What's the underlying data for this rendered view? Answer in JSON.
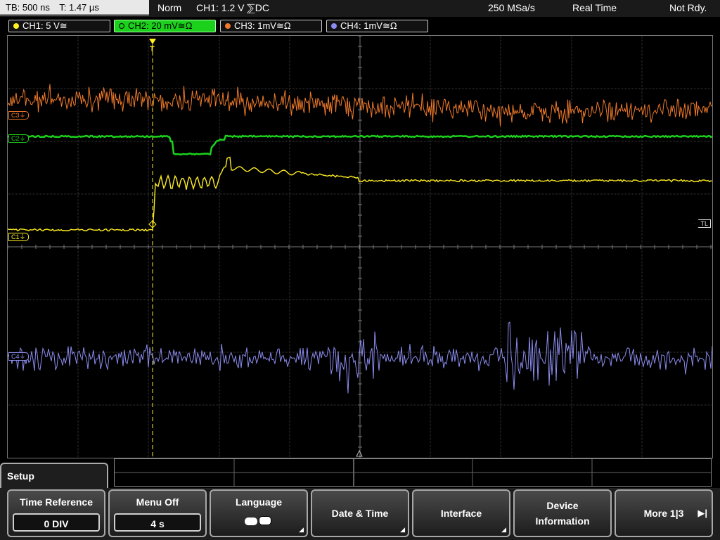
{
  "status_bar": {
    "timebase": "TB: 500 ns",
    "trigger_time": "T: 1.47 µs",
    "mode": "Norm",
    "trigger_info": "CH1: 1.2 V ⅀DC",
    "sample_rate": "250 MSa/s",
    "acq_mode": "Real Time",
    "state": "Not Rdy."
  },
  "channels": [
    {
      "label": "CH1: 5 V≅",
      "color": "#ffee22",
      "active": false
    },
    {
      "label": "CH2: 20 mV≅Ω",
      "color": "#1bd11b",
      "active": true
    },
    {
      "label": "CH3: 1mV≅Ω",
      "color": "#f07a2a",
      "active": false
    },
    {
      "label": "CH4: 1mV≅Ω",
      "color": "#8c8cf0",
      "active": false
    }
  ],
  "markers": {
    "c3": "C3⏚",
    "c2": "C2⏚",
    "c1": "C1⏚",
    "c4": "C4⏚",
    "trigger_level": "TL",
    "trigger_position": "T"
  },
  "menu": {
    "title": "Setup",
    "softkeys": [
      {
        "label": "Time Reference",
        "value": "0 DIV"
      },
      {
        "label": "Menu Off",
        "value": "4 s"
      },
      {
        "label": "Language",
        "icon": "speech-bubbles-icon"
      },
      {
        "label": "Date & Time"
      },
      {
        "label": "Interface"
      },
      {
        "label_line1": "Device",
        "label_line2": "Information"
      },
      {
        "label": "More 1|3",
        "icon": "right-arrow-icon"
      }
    ]
  }
}
